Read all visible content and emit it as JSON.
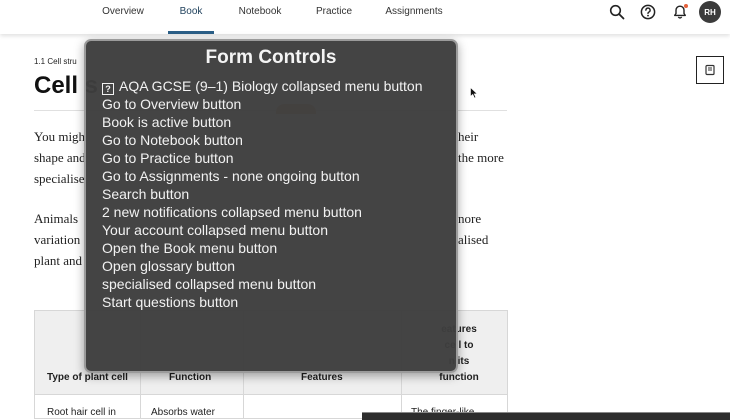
{
  "nav": {
    "tabs": [
      {
        "label": "Overview"
      },
      {
        "label": "Book"
      },
      {
        "label": "Notebook"
      },
      {
        "label": "Practice"
      },
      {
        "label": "Assignments"
      }
    ],
    "active_tab": "Book",
    "avatar_initials": "RH",
    "icons": [
      "search-icon",
      "help-icon",
      "bell-icon"
    ],
    "colors": {
      "active_tab": "#22435e",
      "underline": "#2b5f87",
      "notification": "#e5613b"
    }
  },
  "page": {
    "breadcrumb": "1.1 Cell stru",
    "title": "Cell s",
    "para1_left": [
      "You migh",
      "shape and",
      "specialise"
    ],
    "para1_right": [
      "heir",
      "the more"
    ],
    "para2_left": [
      "Animals",
      "variation",
      "plant and"
    ],
    "para2_right": [
      "nore",
      "alised"
    ]
  },
  "table": {
    "headers": [
      "Type of plant cell",
      "Function",
      "Features",
      "eatures\ncell to\nn its\nfunction"
    ],
    "row1": [
      "Root hair cell in",
      "Absorbs water",
      "The finger-like"
    ]
  },
  "overlay": {
    "title": "Form Controls",
    "items": [
      "AQA GCSE (9–1) Biology collapsed menu button",
      "Go to Overview button",
      "Book is active button",
      "Go to Notebook button",
      "Go to Practice button",
      "Go to Assignments - none ongoing button",
      "Search button",
      "2 new notifications collapsed menu button",
      "Your account collapsed menu button",
      "Open the Book menu button",
      "Open glossary button",
      "specialised collapsed menu button",
      "Start questions button"
    ],
    "first_item_icon": "question-box-icon",
    "qbox_glyph": "?"
  }
}
